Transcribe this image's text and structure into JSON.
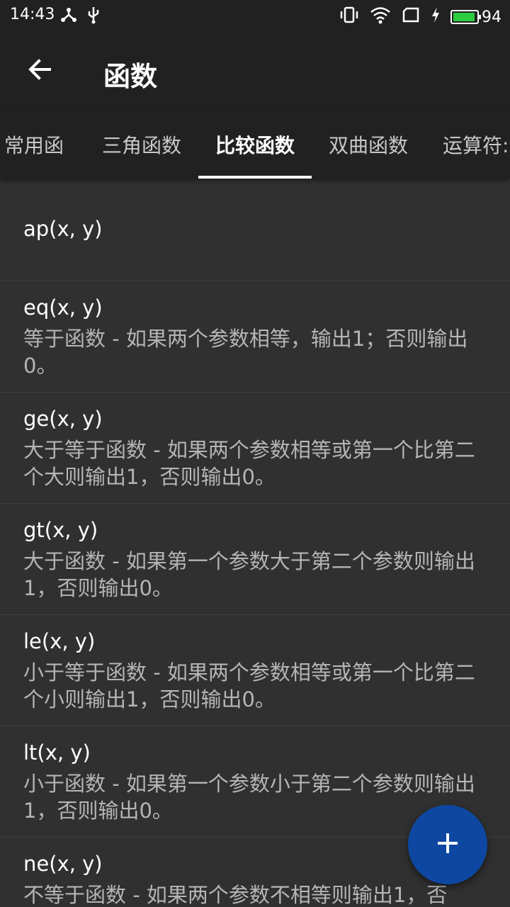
{
  "status_bar": {
    "time": "14:43",
    "battery_level": "94",
    "battery_fill": 0.94,
    "icons_left": [
      "usb-share-icon",
      "usb-icon"
    ],
    "icons_right": [
      "vibrate-icon",
      "wifi-icon",
      "sim-card-icon",
      "charging-icon",
      "battery-icon"
    ]
  },
  "app_bar": {
    "back_icon": "arrow-back-icon",
    "title": "函数"
  },
  "tabs": [
    {
      "label": "常用函",
      "active": false
    },
    {
      "label": "三角函数",
      "active": false
    },
    {
      "label": "比较函数",
      "active": true
    },
    {
      "label": "双曲函数",
      "active": false
    },
    {
      "label": "运算符:",
      "active": false
    }
  ],
  "functions": [
    {
      "name": "ap(x, y)",
      "desc": ""
    },
    {
      "name": "eq(x, y)",
      "desc": "等于函数 - 如果两个参数相等，输出1；否则输出0。"
    },
    {
      "name": "ge(x, y)",
      "desc": "大于等于函数 - 如果两个参数相等或第一个比第二个大则输出1，否则输出0。"
    },
    {
      "name": "gt(x, y)",
      "desc": "大于函数 - 如果第一个参数大于第二个参数则输出1，否则输出0。"
    },
    {
      "name": "le(x, y)",
      "desc": "小于等于函数 - 如果两个参数相等或第一个比第二个小则输出1，否则输出0。"
    },
    {
      "name": "lt(x, y)",
      "desc": "小于函数 - 如果第一个参数小于第二个参数则输出1，否则输出0。"
    },
    {
      "name": "ne(x, y)",
      "desc": "不等于函数 - 如果两个参数不相等则输出1，否"
    }
  ],
  "fab": {
    "icon": "plus-icon",
    "color": "#0d47a1"
  },
  "colors": {
    "background": "#303030",
    "bar": "#212121",
    "accent": "#0d47a1",
    "battery": "#2ecc40"
  }
}
